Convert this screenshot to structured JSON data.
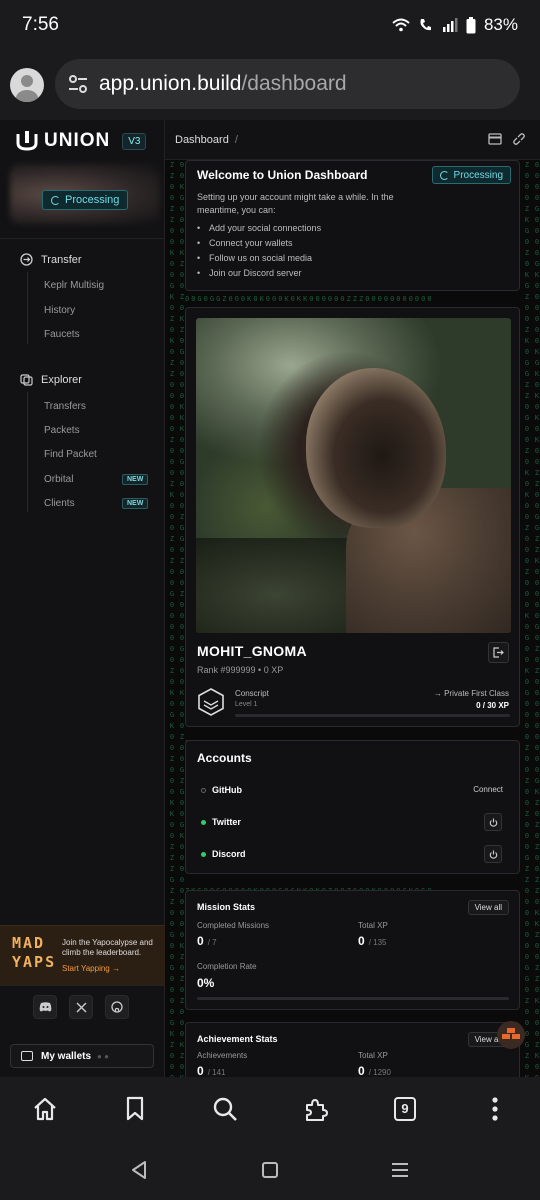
{
  "status": {
    "time": "7:56",
    "battery": "83%"
  },
  "browser": {
    "url_host": "app.union.build",
    "url_path": "/dashboard",
    "tab_count": "9"
  },
  "sidebar": {
    "logo": "UNION",
    "version": "V3",
    "status_badge": "Processing",
    "sections": [
      {
        "title": "Transfer",
        "items": [
          "Keplr Multisig",
          "History",
          "Faucets"
        ]
      },
      {
        "title": "Explorer",
        "items": [
          "Transfers",
          "Packets",
          "Find Packet",
          "Orbital",
          "Clients"
        ]
      }
    ],
    "new_badge": "NEW",
    "promo": {
      "logo_line1": "MAD",
      "logo_line2": "YAPS",
      "text": "Join the Yapocalypse and climb the leaderboard.",
      "cta": "Start Yapping →"
    },
    "wallets_label": "My wallets"
  },
  "topbar": {
    "breadcrumb": "Dashboard",
    "separator": "/"
  },
  "welcome": {
    "title": "Welcome to Union Dashboard",
    "badge": "Processing",
    "description": "Setting up your account might take a while. In the meantime, you can:",
    "items": [
      "Add your social connections",
      "Connect your wallets",
      "Follow us on social media",
      "Join our Discord server"
    ]
  },
  "profile": {
    "username": "MOHIT_GNOMA",
    "rank": "Rank #999999 • 0 XP",
    "level_name": "Conscript",
    "level": "Level 1",
    "next_rank": "→ Private First Class",
    "xp": "0 / 30 XP",
    "progress": 0
  },
  "accounts": {
    "title": "Accounts",
    "rows": [
      {
        "name": "GitHub",
        "status": "disconnected",
        "action": "Connect"
      },
      {
        "name": "Twitter",
        "status": "connected"
      },
      {
        "name": "Discord",
        "status": "connected"
      }
    ]
  },
  "mission_stats": {
    "title": "Mission Stats",
    "view_all": "View all",
    "completed_label": "Completed Missions",
    "completed_value": "0",
    "completed_total": "/ 7",
    "xp_label": "Total XP",
    "xp_value": "0",
    "xp_total": "/ 135",
    "rate_label": "Completion Rate",
    "rate_value": "0%"
  },
  "achievement_stats": {
    "title": "Achievement Stats",
    "view_all": "View all",
    "achievements_label": "Achievements",
    "achievements_value": "0",
    "achievements_total": "/ 141",
    "xp_label": "Total XP",
    "xp_value": "0",
    "xp_total": "/ 1290"
  },
  "colors": {
    "accent": "#6fdbe5",
    "connected": "#2ecc71",
    "promo": "#f59a3c"
  }
}
